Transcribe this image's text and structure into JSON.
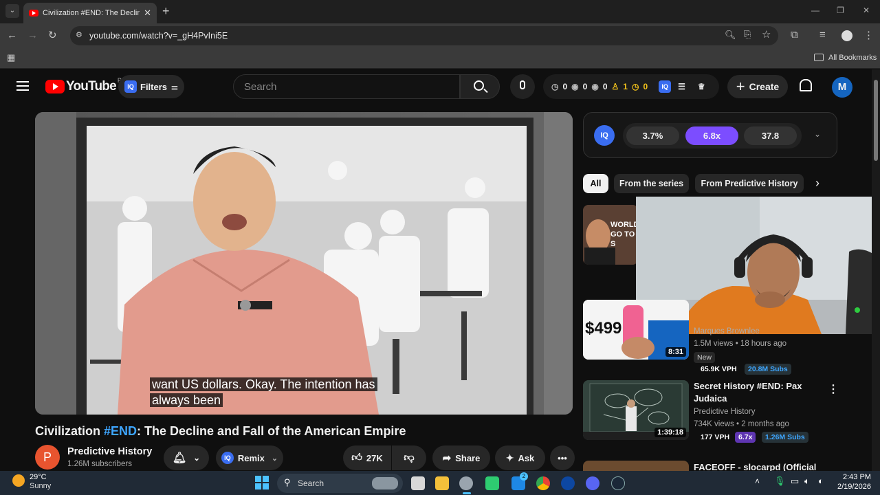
{
  "browser": {
    "tab_title": "Civilization #END: The Decline a",
    "tab_close": "✕",
    "new_tab": "+",
    "url": "youtube.com/watch?v=_gH4PvIni5E",
    "bookmarks_label": "All Bookmarks"
  },
  "youtube": {
    "logo_text": "YouTube",
    "country": "PK",
    "filters_label": "Filters",
    "search_placeholder": "Search",
    "stats": {
      "a": "0",
      "b": "0",
      "c": "0",
      "d": "1",
      "e": "0"
    },
    "create_label": "Create",
    "avatar_letter": "M"
  },
  "video": {
    "caption_line1": "want US dollars. Okay. The intention has",
    "caption_line2": "always been",
    "title_prefix": "Civilization ",
    "title_hashtag": "#END",
    "title_suffix": ": The Decline and Fall of the American Empire",
    "channel_name": "Predictive History",
    "channel_initial": "P",
    "subscribers": "1.26M subscribers",
    "remix_label": "Remix",
    "likes": "27K",
    "share_label": "Share",
    "ask_label": "Ask"
  },
  "iq_panel": {
    "stat1": "3.7%",
    "stat2": "6.8x",
    "stat3": "37.8"
  },
  "chips": [
    "All",
    "From the series",
    "From Predictive History"
  ],
  "related": [
    {
      "thumb_text": "WORLD GO TO S",
      "title": "",
      "channel": "",
      "views": "",
      "duration": ""
    },
    {
      "thumb_text": "$499",
      "channel": "Marques Brownlee",
      "views": "1.5M views • 18 hours ago",
      "new_badge": "New",
      "vph": "65.9K VPH",
      "subs": "20.8M Subs",
      "duration": "8:31"
    },
    {
      "title_line1": "Secret History #END:  Pax",
      "title_line2": "Judaica",
      "channel": "Predictive History",
      "views": "734K views • 2 months ago",
      "vph": "177 VPH",
      "mult": "6.7x",
      "subs": "1.26M Subs",
      "duration": "1:39:18"
    },
    {
      "title_line1": "FACEOFF - slocarpd (Official"
    }
  ],
  "taskbar": {
    "temp": "29°C",
    "weather": "Sunny",
    "search_label": "Search",
    "time": "2:43 PM",
    "date": "2/19/2026",
    "mail_count": "2"
  },
  "colors": {
    "yt_red": "#ff0000",
    "iq_blue": "#3a6df0",
    "iq_purple": "#7c4dff",
    "hashtag_blue": "#3ea6ff",
    "avatar_blue": "#1565c0"
  }
}
